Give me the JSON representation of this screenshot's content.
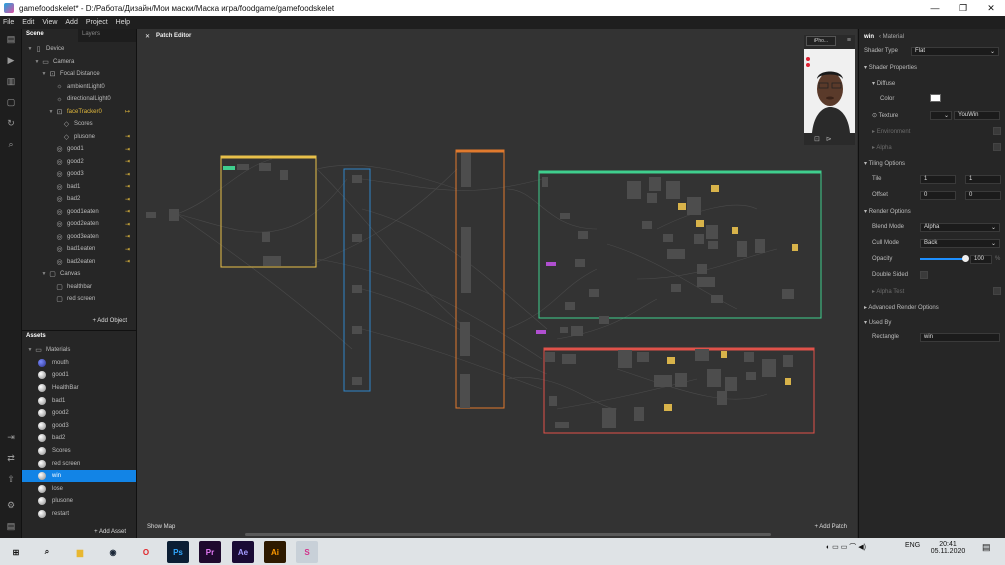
{
  "window": {
    "title": "gamefoodskelet* - D:/Работа/Дизайн/Мои маски/Маска игра/foodgame/gamefoodskelet",
    "minimize": "—",
    "maximize": "❐",
    "close": "✕"
  },
  "menu": [
    "File",
    "Edit",
    "View",
    "Add",
    "Project",
    "Help"
  ],
  "scene": {
    "tab_scene": "Scene",
    "tab_layers": "Layers",
    "tree": [
      {
        "label": "Device",
        "indent": 0,
        "icon": "device-icon",
        "glyph": "▯",
        "tri": "▼"
      },
      {
        "label": "Camera",
        "indent": 1,
        "icon": "camera-icon",
        "glyph": "▭",
        "tri": "▼"
      },
      {
        "label": "Focal Distance",
        "indent": 2,
        "icon": "focal-distance-icon",
        "glyph": "⊡",
        "tri": "▼"
      },
      {
        "label": "ambientLight0",
        "indent": 3,
        "icon": "light-icon",
        "glyph": "☼",
        "tri": ""
      },
      {
        "label": "directionalLight0",
        "indent": 3,
        "icon": "light-icon",
        "glyph": "☼",
        "tri": ""
      },
      {
        "label": "faceTracker0",
        "indent": 3,
        "icon": "face-tracker-icon",
        "glyph": "⊡",
        "tri": "▼",
        "selected": true,
        "badge": "↦"
      },
      {
        "label": "Scores",
        "indent": 4,
        "icon": "visibility-icon",
        "glyph": "◇",
        "tri": ""
      },
      {
        "label": "plusone",
        "indent": 4,
        "icon": "visibility-icon",
        "glyph": "◇",
        "tri": "",
        "badge": "⇥"
      },
      {
        "label": "good1",
        "indent": 3,
        "icon": "plane-icon",
        "glyph": "◎",
        "tri": "",
        "badge": "⇥"
      },
      {
        "label": "good2",
        "indent": 3,
        "icon": "plane-icon",
        "glyph": "◎",
        "tri": "",
        "badge": "⇥"
      },
      {
        "label": "good3",
        "indent": 3,
        "icon": "plane-icon",
        "glyph": "◎",
        "tri": "",
        "badge": "⇥"
      },
      {
        "label": "bad1",
        "indent": 3,
        "icon": "plane-icon",
        "glyph": "◎",
        "tri": "",
        "badge": "⇥"
      },
      {
        "label": "bad2",
        "indent": 3,
        "icon": "plane-icon",
        "glyph": "◎",
        "tri": "",
        "badge": "⇥"
      },
      {
        "label": "good1eaten",
        "indent": 3,
        "icon": "plane-icon",
        "glyph": "◎",
        "tri": "",
        "badge": "⇥"
      },
      {
        "label": "good2eaten",
        "indent": 3,
        "icon": "plane-icon",
        "glyph": "◎",
        "tri": "",
        "badge": "⇥"
      },
      {
        "label": "good3eaten",
        "indent": 3,
        "icon": "plane-icon",
        "glyph": "◎",
        "tri": "",
        "badge": "⇥"
      },
      {
        "label": "bad1eaten",
        "indent": 3,
        "icon": "plane-icon",
        "glyph": "◎",
        "tri": "",
        "badge": "⇥"
      },
      {
        "label": "bad2eaten",
        "indent": 3,
        "icon": "plane-icon",
        "glyph": "◎",
        "tri": "",
        "badge": "⇥"
      },
      {
        "label": "Canvas",
        "indent": 2,
        "icon": "canvas-icon",
        "glyph": "▢",
        "tri": "▼"
      },
      {
        "label": "healthbar",
        "indent": 3,
        "icon": "rectangle-icon",
        "glyph": "▢",
        "tri": ""
      },
      {
        "label": "red screen",
        "indent": 3,
        "icon": "rectangle-icon",
        "glyph": "▢",
        "tri": ""
      }
    ],
    "add_object": "+ Add Object"
  },
  "assets": {
    "header": "Assets",
    "folder": "Materials",
    "items": [
      "mouth",
      "good1",
      "HealthBar",
      "bad1",
      "good2",
      "good3",
      "bad2",
      "Scores",
      "red screen",
      "win",
      "lose",
      "plusone",
      "restart"
    ],
    "selected": "win",
    "add_asset": "+ Add Asset"
  },
  "patch_editor": {
    "tab": "Patch Editor",
    "close": "✕",
    "show_map": "Show Map",
    "add_patch": "+ Add Patch",
    "group_colors": [
      "#e8c04a",
      "#2f86c9",
      "#e07a2e",
      "#3fcf8e",
      "#e0524a"
    ]
  },
  "preview": {
    "device": "iPho...",
    "menu": "≡",
    "controls": "⊡⊳"
  },
  "inspector": {
    "name": "win",
    "type": "‹ Material",
    "shader_type_label": "Shader Type",
    "shader_type": "Flat",
    "shader_properties": "Shader Properties",
    "diffuse": "Diffuse",
    "color_label": "Color",
    "color_value": "#ffffff",
    "texture_label": "Texture",
    "texture_value": "YouWin",
    "environment": "Environment",
    "alpha": "Alpha",
    "tiling_options": "Tiling Options",
    "tile_label": "Tile",
    "tile_x": "1",
    "tile_y": "1",
    "offset_label": "Offset",
    "offset_x": "0",
    "offset_y": "0",
    "render_options": "Render Options",
    "blend_mode_label": "Blend Mode",
    "blend_mode": "Alpha",
    "cull_mode_label": "Cull Mode",
    "cull_mode": "Back",
    "opacity_label": "Opacity",
    "opacity_value": "100",
    "opacity_unit": "%",
    "opacity_level": 1.0,
    "double_sided_label": "Double Sided",
    "alpha_test": "Alpha Test",
    "advanced_render": "Advanced Render Options",
    "used_by": "Used By",
    "rectangle_label": "Rectangle",
    "rectangle_value": "win"
  },
  "taskbar": {
    "time": "20:41",
    "date": "05.11.2020",
    "lang": "ENG",
    "apps": [
      {
        "name": "start-icon",
        "glyph": "⊞",
        "bg": "transparent",
        "fg": "#111"
      },
      {
        "name": "search-icon",
        "glyph": "⌕",
        "bg": "transparent",
        "fg": "#111"
      },
      {
        "name": "file-explorer-icon",
        "glyph": "▆",
        "bg": "transparent",
        "fg": "#e8b730"
      },
      {
        "name": "steam-icon",
        "glyph": "◉",
        "bg": "transparent",
        "fg": "#1b2838"
      },
      {
        "name": "opera-icon",
        "glyph": "O",
        "bg": "transparent",
        "fg": "#e0262b"
      },
      {
        "name": "photoshop-icon",
        "glyph": "Ps",
        "bg": "#0b1e34",
        "fg": "#31a8ff"
      },
      {
        "name": "premiere-icon",
        "glyph": "Pr",
        "bg": "#1f0a2e",
        "fg": "#e77cf9"
      },
      {
        "name": "after-effects-icon",
        "glyph": "Ae",
        "bg": "#1a0b35",
        "fg": "#a49cff"
      },
      {
        "name": "illustrator-icon",
        "glyph": "Ai",
        "bg": "#2e1a00",
        "fg": "#ff9a00"
      },
      {
        "name": "spark-ar-icon",
        "glyph": "S",
        "bg": "#c8d0d8",
        "fg": "#d2308a"
      }
    ]
  }
}
